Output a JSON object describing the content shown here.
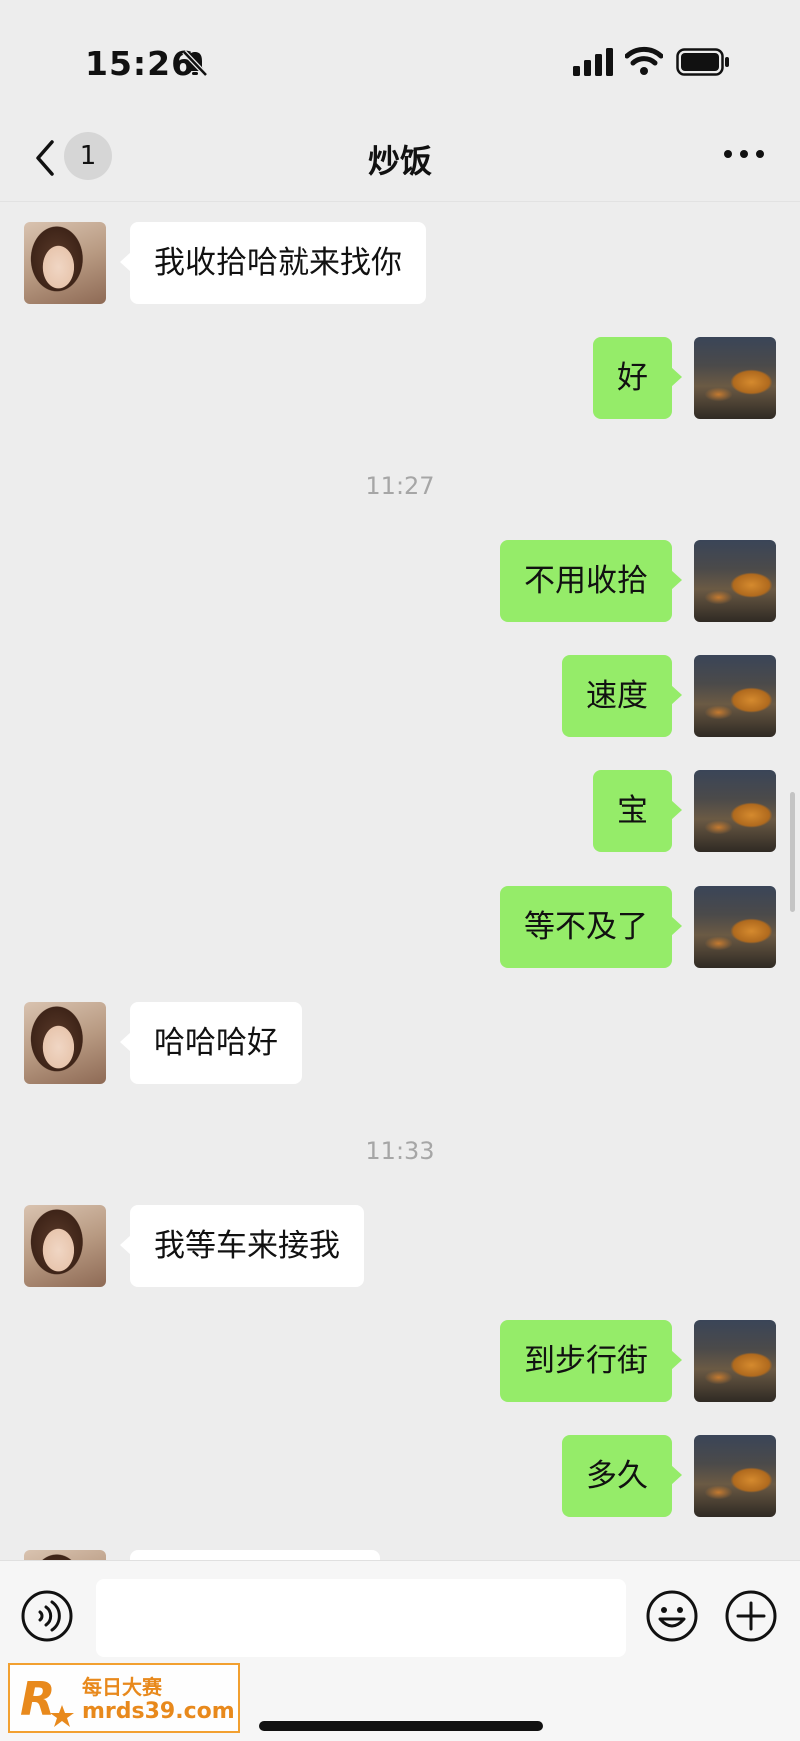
{
  "status_bar": {
    "time": "15:26",
    "icons": [
      "bell-off-icon",
      "signal-icon",
      "wifi-icon",
      "battery-icon"
    ]
  },
  "nav": {
    "back_icon": "chevron-left-icon",
    "unread_count": "1",
    "title": "炒饭",
    "more_icon": "more-dots-icon"
  },
  "colors": {
    "background": "#ededed",
    "sent_bubble": "#95ec69",
    "received_bubble": "#ffffff",
    "timestamp": "#a6a6a6"
  },
  "messages": [
    {
      "side": "left",
      "text": "我收拾哈就来找你"
    },
    {
      "side": "right",
      "text": "好"
    },
    {
      "type": "timestamp",
      "text": "11:27"
    },
    {
      "side": "right",
      "text": "不用收拾"
    },
    {
      "side": "right",
      "text": "速度"
    },
    {
      "side": "right",
      "text": "宝"
    },
    {
      "side": "right",
      "text": "等不及了"
    },
    {
      "side": "left",
      "text": "哈哈哈好"
    },
    {
      "type": "timestamp",
      "text": "11:33"
    },
    {
      "side": "left",
      "text": "我等车来接我"
    },
    {
      "side": "right",
      "text": "到步行街"
    },
    {
      "side": "right",
      "text": "多久"
    },
    {
      "side": "left",
      "text": ""
    }
  ],
  "input_bar": {
    "voice_icon": "voice-icon",
    "text_value": "",
    "emoji_icon": "emoji-icon",
    "plus_icon": "plus-icon"
  },
  "watermark": {
    "logo_letter": "R",
    "line1": "每日大赛",
    "line2": "mrds39.com"
  }
}
